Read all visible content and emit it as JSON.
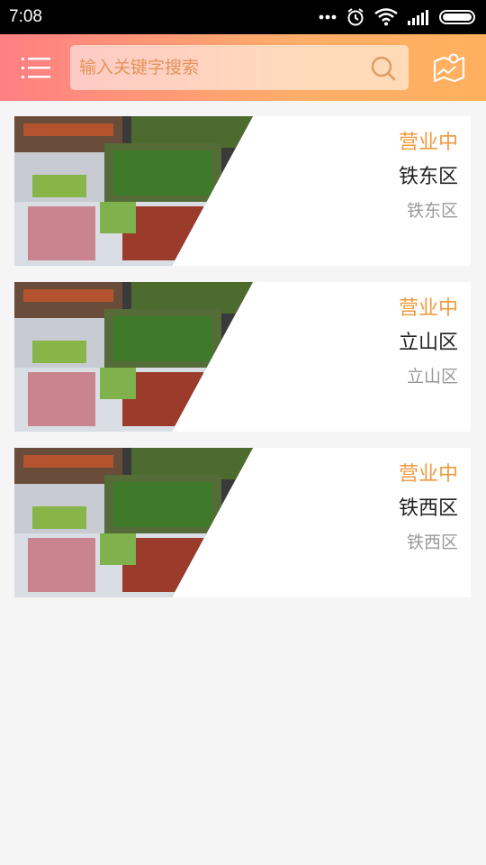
{
  "statusbar": {
    "time": "7:08"
  },
  "header": {
    "search_placeholder": "输入关键字搜索"
  },
  "shops": [
    {
      "status": "营业中",
      "name": "铁东区",
      "district": "铁东区"
    },
    {
      "status": "营业中",
      "name": "立山区",
      "district": "立山区"
    },
    {
      "status": "营业中",
      "name": "铁西区",
      "district": "铁西区"
    }
  ],
  "colors": {
    "accent": "#f09a3e",
    "header_start": "#ff7f83",
    "header_end": "#ffb05e"
  },
  "icons": {
    "menu": "menu-icon",
    "search": "search-icon",
    "map": "map-icon"
  }
}
